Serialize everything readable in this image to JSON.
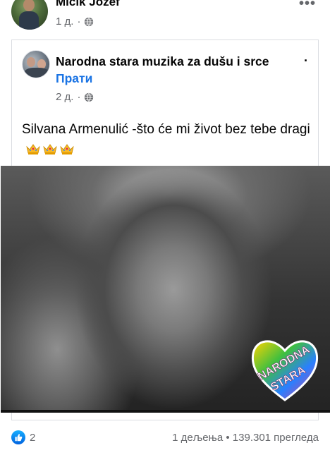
{
  "outer_post": {
    "author_name": "Micik Jozef",
    "time": "1 д.",
    "visibility_icon": "globe-icon",
    "more_icon": "more-options-icon"
  },
  "shared_post": {
    "page_name": "Narodna stara muzika za dušu i srce",
    "separator": "·",
    "follow_label": "Прати",
    "time": "2 д.",
    "visibility_icon": "globe-icon",
    "text": "Silvana Armenulić -što će mi život bez tebe dragi",
    "emoji": [
      "crown-emoji",
      "crown-emoji",
      "crown-emoji"
    ],
    "video": {
      "watermark_line1": "NARODNA",
      "watermark_line2": "STARA"
    }
  },
  "footer": {
    "reaction_icon": "like-icon",
    "reaction_count": "2",
    "shares": "1 дељења",
    "dot": "•",
    "views": "139.301 прегледа"
  },
  "colors": {
    "link_blue": "#1b74e4",
    "meta_gray": "#65676b",
    "like_blue": "#0062df"
  }
}
